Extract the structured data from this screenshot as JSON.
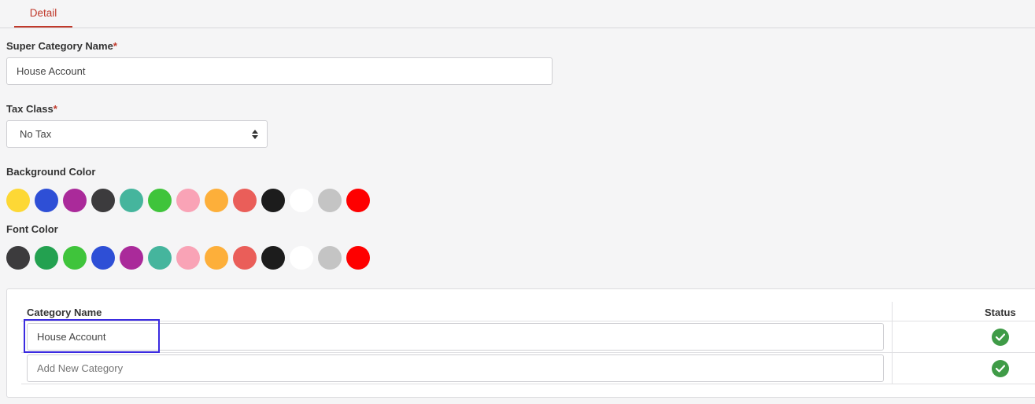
{
  "tabs": [
    {
      "label": "Detail",
      "active": true
    }
  ],
  "super_category": {
    "label": "Super Category Name",
    "required_mark": "*",
    "value": "House Account"
  },
  "tax_class": {
    "label": "Tax Class",
    "required_mark": "*",
    "selected": "No Tax"
  },
  "background_color": {
    "label": "Background Color",
    "swatches": [
      "#fdd835",
      "#2e4fd6",
      "#aa2a9a",
      "#3c3b3d",
      "#45b59d",
      "#3fc43b",
      "#f9a3b6",
      "#fdaf3a",
      "#ea5e59",
      "#1c1c1c",
      "#ffffff",
      "#c4c4c4",
      "#fe0000"
    ]
  },
  "font_color": {
    "label": "Font Color",
    "swatches": [
      "#3c3b3d",
      "#23a150",
      "#3fc43b",
      "#2e4fd6",
      "#aa2a9a",
      "#45b59d",
      "#f9a3b6",
      "#fdaf3a",
      "#ea5e59",
      "#1c1c1c",
      "#ffffff",
      "#c4c4c4",
      "#fe0000"
    ]
  },
  "categories_table": {
    "headers": {
      "name": "Category Name",
      "status": "Status"
    },
    "rows": [
      {
        "name": "House Account",
        "status_icon": "check-circle-icon"
      },
      {
        "placeholder": "Add New Category",
        "status_icon": "check-circle-icon"
      }
    ]
  },
  "colors": {
    "accent": "#c0392b",
    "status_ok": "#3f9b47",
    "highlight": "#3b2be0"
  }
}
